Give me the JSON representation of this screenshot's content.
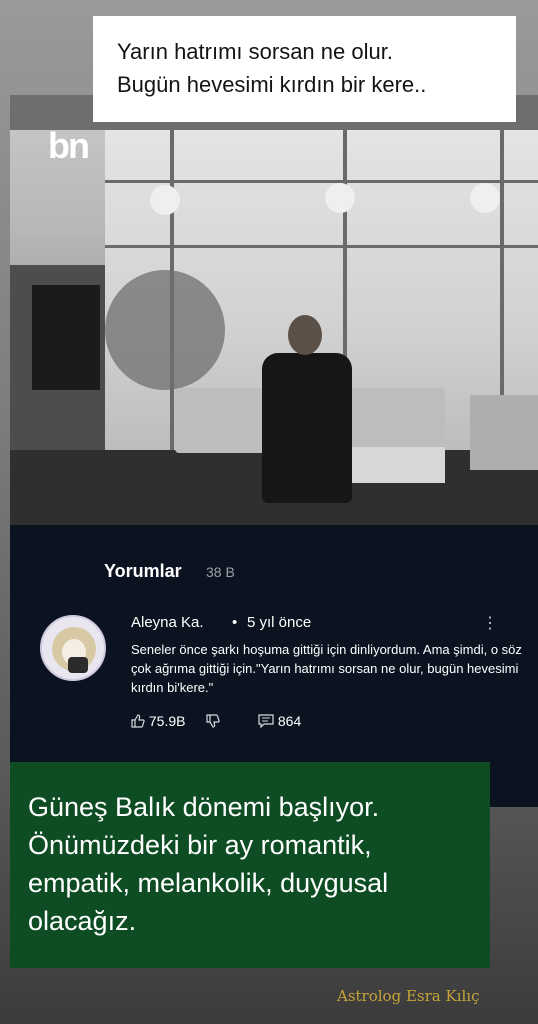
{
  "header": {
    "logo_text": "bn",
    "lyric_lines": [
      "Yarın hatrımı sorsan ne olur.",
      "Bugün hevesimi kırdın bir kere.."
    ]
  },
  "comments_panel": {
    "title": "Yorumlar",
    "count": "38 B",
    "comment": {
      "author": "Aleyna Ka.",
      "separator": "•",
      "time": "5 yıl önce",
      "text": "Seneler önce şarkı hoşuma gittiği için dinliyordum. Ama şimdi, o söz çok ağrıma gittiği için.\"Yarın hatrımı sorsan ne olur, bugün hevesimi kırdın bi'kere.\"",
      "likes": "75.9B",
      "replies": "864",
      "icons": [
        "thumbs-up-icon",
        "thumbs-down-icon",
        "reply-icon",
        "more-options-icon"
      ]
    }
  },
  "overlay_text": {
    "lines": [
      "Güneş Balık dönemi başlıyor.",
      "Önümüzdeki bir ay romantik,",
      "empatik, melankolik, duygusal",
      "olacağız."
    ]
  },
  "signature": "Astrolog Esra Kılıç",
  "colors": {
    "green_box": "#0e4d24",
    "comments_bg": "#0b1320",
    "signature": "#c7a436"
  }
}
